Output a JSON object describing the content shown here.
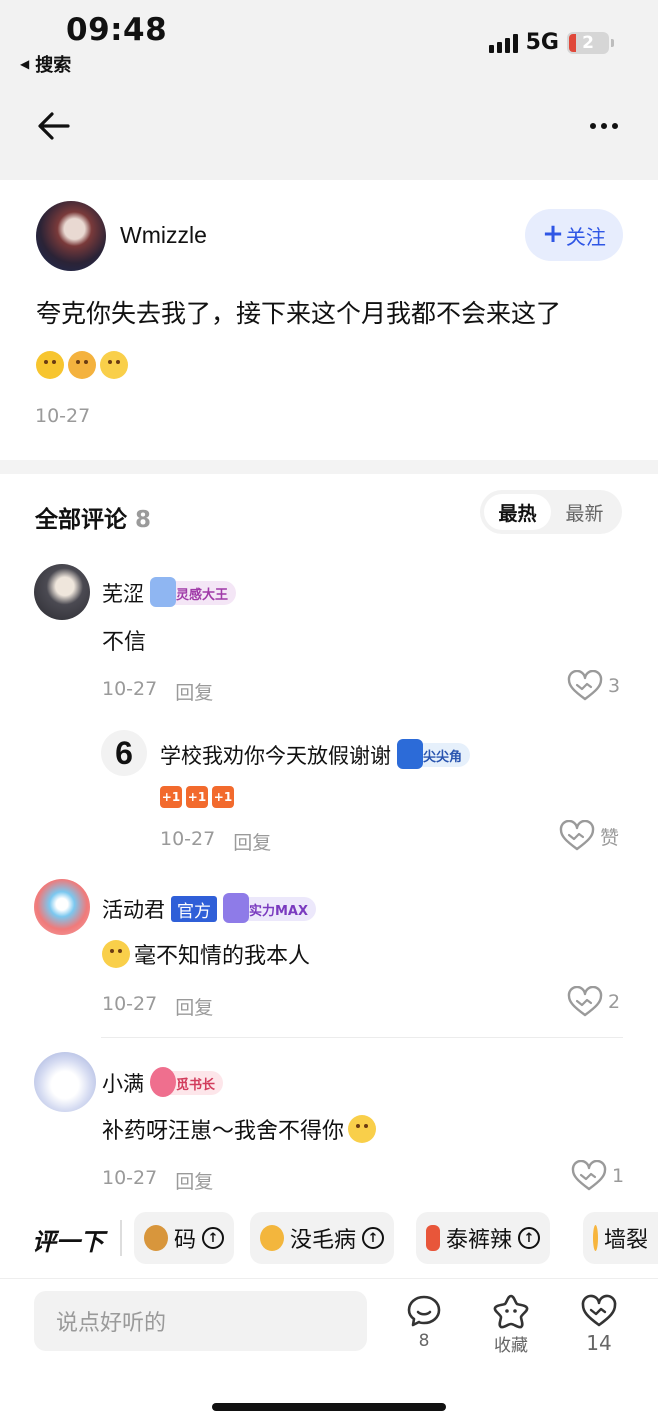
{
  "status_bar": {
    "time": "09:48",
    "back_app": "搜索",
    "network": "5G",
    "battery": "2"
  },
  "post": {
    "author": "Wmizzle",
    "follow_label": "关注",
    "text": "夸克你失去我了，接下来这个月我都不会来这了",
    "date": "10-27"
  },
  "comments_header": {
    "title": "全部评论",
    "count": "8",
    "sort_hot": "最热",
    "sort_new": "最新"
  },
  "comments": [
    {
      "name": "芜涩",
      "badge": "灵感大王",
      "text": "不信",
      "date": "10-27",
      "reply": "回复",
      "likes": "3"
    },
    {
      "name": "学校我劝你今天放假谢谢",
      "badge": "尖尖角",
      "reply_prefix": "6",
      "date": "10-27",
      "reply": "回复",
      "likes": "赞"
    },
    {
      "name": "活动君",
      "official": "官方",
      "badge": "实力MAX",
      "text": "毫不知情的我本人",
      "date": "10-27",
      "reply": "回复",
      "likes": "2"
    },
    {
      "name": "小满",
      "badge": "觅书长",
      "text": "补药呀汪崽～我舍不得你",
      "date": "10-27",
      "reply": "回复",
      "likes": "1"
    }
  ],
  "quick_bar": {
    "label": "评一下",
    "chips": [
      "码",
      "没毛病",
      "泰裤辣",
      "墙裂"
    ]
  },
  "bottom_bar": {
    "placeholder": "说点好听的",
    "comment_count": "8",
    "favorite_label": "收藏",
    "like_count": "14"
  },
  "colors": {
    "accent": "#2f56e5",
    "official": "#2f5fd8",
    "plus_one": "#f26a2d"
  }
}
